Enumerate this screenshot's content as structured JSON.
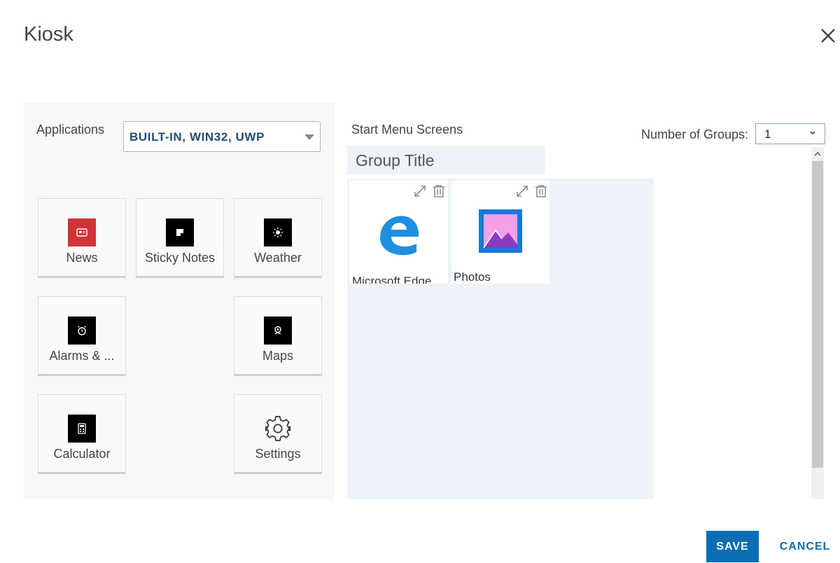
{
  "dialog": {
    "title": "Kiosk"
  },
  "applications": {
    "label": "Applications",
    "filter_value": "BUILT-IN, WIN32, UWP",
    "tiles": [
      {
        "label": "News",
        "icon": "news-icon"
      },
      {
        "label": "Sticky Notes",
        "icon": "sticky-notes-icon"
      },
      {
        "label": "Weather",
        "icon": "weather-icon"
      },
      {
        "label": "Alarms & ...",
        "icon": "alarm-clock-icon"
      },
      {
        "label": "Maps",
        "icon": "maps-icon"
      },
      {
        "label": "Calculator",
        "icon": "calculator-icon"
      },
      {
        "label": "Settings",
        "icon": "gear-icon"
      }
    ]
  },
  "start_menu": {
    "label": "Start Menu Screens",
    "groups_label": "Number of Groups:",
    "groups_value": "1",
    "group_title": "Group Title",
    "pinned": [
      {
        "label": "Microsoft Edge",
        "icon": "edge-icon"
      },
      {
        "label": "Photos",
        "icon": "photos-icon"
      }
    ]
  },
  "footer": {
    "save_label": "SAVE",
    "cancel_label": "CANCEL"
  },
  "colors": {
    "accent": "#0a6eb4",
    "group_background": "#edf3f8",
    "news_red": "#d13438",
    "edge_blue": "#1f8fe0",
    "photos_blue": "#1a78d6"
  }
}
